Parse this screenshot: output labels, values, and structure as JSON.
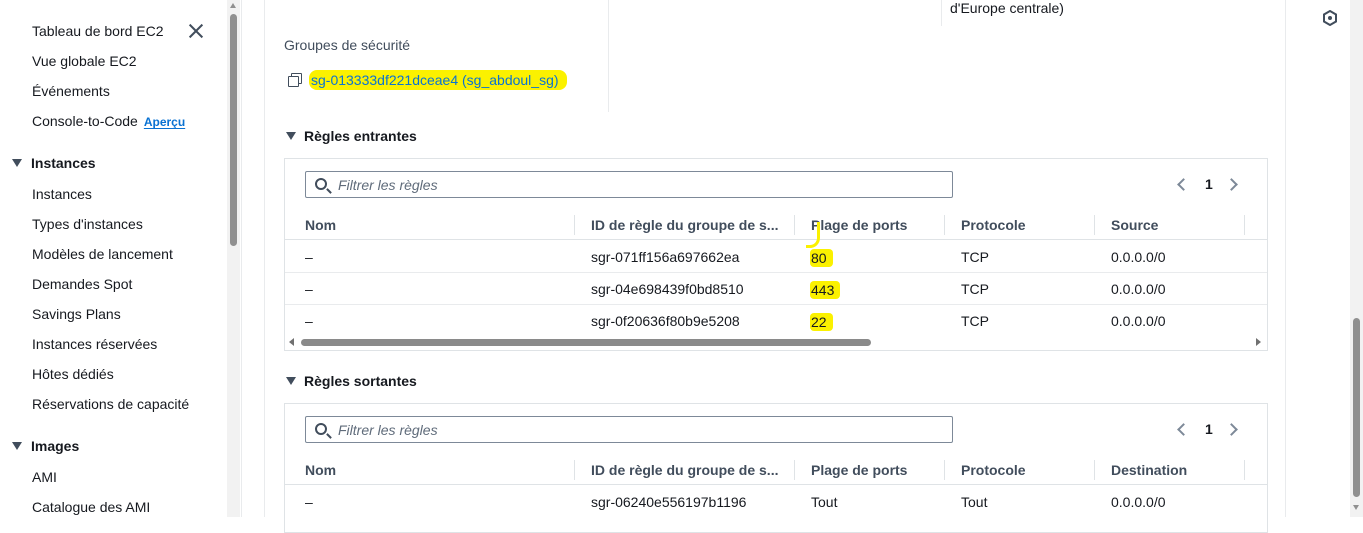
{
  "sidebar": {
    "items_top": [
      {
        "label": "Tableau de bord EC2"
      },
      {
        "label": "Vue globale EC2"
      },
      {
        "label": "Événements"
      },
      {
        "label": "Console-to-Code",
        "badge": "Aperçu"
      }
    ],
    "sections": [
      {
        "title": "Instances",
        "items": [
          "Instances",
          "Types d'instances",
          "Modèles de lancement",
          "Demandes Spot",
          "Savings Plans",
          "Instances réservées",
          "Hôtes dédiés",
          "Réservations de capacité"
        ]
      },
      {
        "title": "Images",
        "items": [
          "AMI",
          "Catalogue des AMI"
        ]
      }
    ]
  },
  "details": {
    "region_tail": "d'Europe centrale)",
    "security_groups_label": "Groupes de sécurité",
    "security_group_link": "sg-013333df221dceae4 (sg_abdoul_sg)"
  },
  "inbound": {
    "title": "Règles entrantes",
    "filter_placeholder": "Filtrer les règles",
    "page": "1",
    "columns": [
      "Nom",
      "ID de règle du groupe de s...",
      "Plage de ports",
      "Protocole",
      "Source"
    ],
    "rows": [
      {
        "name": "–",
        "id": "sgr-071ff156a697662ea",
        "ports": "80",
        "protocol": "TCP",
        "source": "0.0.0.0/0"
      },
      {
        "name": "–",
        "id": "sgr-04e698439f0bd8510",
        "ports": "443",
        "protocol": "TCP",
        "source": "0.0.0.0/0"
      },
      {
        "name": "–",
        "id": "sgr-0f20636f80b9e5208",
        "ports": "22",
        "protocol": "TCP",
        "source": "0.0.0.0/0"
      }
    ]
  },
  "outbound": {
    "title": "Règles sortantes",
    "filter_placeholder": "Filtrer les règles",
    "page": "1",
    "columns": [
      "Nom",
      "ID de règle du groupe de s...",
      "Plage de ports",
      "Protocole",
      "Destination"
    ],
    "rows": [
      {
        "name": "–",
        "id": "sgr-06240e556197b1196",
        "ports": "Tout",
        "protocol": "Tout",
        "destination": "0.0.0.0/0"
      }
    ]
  },
  "colors": {
    "highlight": "#fbf100",
    "link": "#0972d3"
  }
}
